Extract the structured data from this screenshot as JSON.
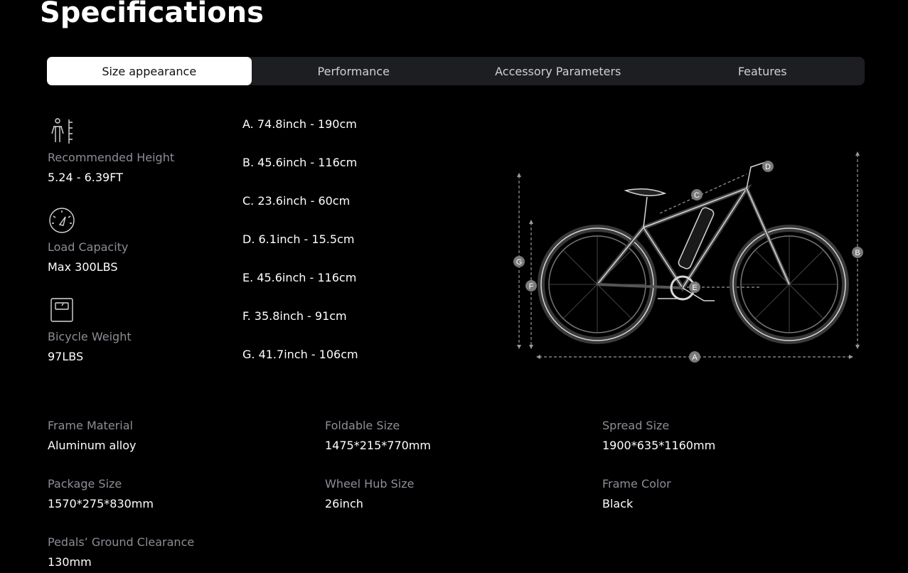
{
  "page": {
    "title": "Specifications"
  },
  "tabs": [
    {
      "label": "Size appearance",
      "active": true
    },
    {
      "label": "Performance",
      "active": false
    },
    {
      "label": "Accessory Parameters",
      "active": false
    },
    {
      "label": "Features",
      "active": false
    }
  ],
  "key_specs": [
    {
      "icon": "person-height-icon",
      "label": "Recommended Height",
      "value": "5.24 - 6.39FT"
    },
    {
      "icon": "gauge-icon",
      "label": "Load Capacity",
      "value": "Max 300LBS"
    },
    {
      "icon": "scale-icon",
      "label": "Bicycle Weight",
      "value": "97LBS"
    }
  ],
  "dimensions": [
    "A. 74.8inch - 190cm",
    "B. 45.6inch - 116cm",
    "C. 23.6inch - 60cm",
    "D. 6.1inch - 15.5cm",
    "E. 45.6inch - 116cm",
    "F. 35.8inch - 91cm",
    "G. 41.7inch - 106cm"
  ],
  "diagram_markers": [
    "A",
    "B",
    "C",
    "D",
    "E",
    "F",
    "G"
  ],
  "specs": [
    {
      "label": "Frame Material",
      "value": "Aluminum alloy"
    },
    {
      "label": "Foldable Size",
      "value": "1475*215*770mm"
    },
    {
      "label": "Spread Size",
      "value": "1900*635*1160mm"
    },
    {
      "label": "Package Size",
      "value": "1570*275*830mm"
    },
    {
      "label": "Wheel Hub Size",
      "value": "26inch"
    },
    {
      "label": "Frame Color",
      "value": "Black"
    },
    {
      "label": "Pedals’ Ground Clearance",
      "value": "130mm"
    }
  ],
  "colors": {
    "background": "#000000",
    "tab_bar": "#1d1e22",
    "active_tab": "#ffffff",
    "muted_text": "#8b8e95"
  }
}
